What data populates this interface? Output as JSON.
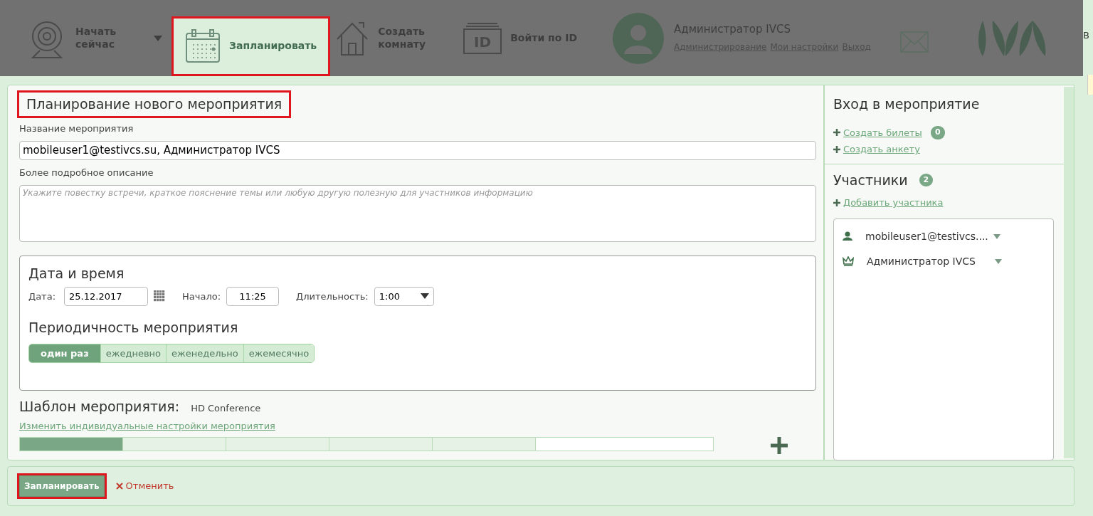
{
  "header": {
    "nav": [
      {
        "kind": "webcam",
        "label": "Начать сейчас",
        "dropdown": true,
        "selected": false,
        "highlighted": false
      },
      {
        "kind": "calendar",
        "label": "Запланировать",
        "dropdown": false,
        "selected": true,
        "highlighted": true
      },
      {
        "kind": "house",
        "label": "Создать комнату",
        "dropdown": false,
        "selected": false,
        "highlighted": false
      },
      {
        "kind": "id",
        "label": "Войти по ID",
        "icon_text": "ID",
        "dropdown": false,
        "selected": false,
        "highlighted": false
      }
    ],
    "user": {
      "name": "Администратор IVCS",
      "links": [
        "Администрирование",
        "Мои настройки",
        "Выход"
      ]
    }
  },
  "form": {
    "title": "Планирование нового мероприятия",
    "highlighted": true,
    "name_label": "Название мероприятия",
    "name_value": "mobileuser1@testivcs.su, Администратор IVCS",
    "description_label": "Более подробное описание",
    "description_placeholder": "Укажите повестку встречи, краткое пояснение темы или любую другую полезную для участников информацию",
    "datetime": {
      "title": "Дата и время",
      "date_label": "Дата:",
      "date": "25.12.2017",
      "start_label": "Начало:",
      "start": "11:25",
      "duration_label": "Длительность:",
      "duration": "1:00"
    },
    "periodicity": {
      "title": "Периодичность мероприятия",
      "options": [
        {
          "label": "один раз",
          "selected": true
        },
        {
          "label": "ежедневно",
          "selected": false
        },
        {
          "label": "еженедельно",
          "selected": false
        },
        {
          "label": "ежемесячно",
          "selected": false
        }
      ]
    },
    "template": {
      "label": "Шаблон мероприятия:",
      "value": "HD Conference",
      "link": "Изменить индивидуальные настройки мероприятия",
      "tabs": [
        {
          "selected": true
        },
        {
          "selected": false
        },
        {
          "selected": false
        },
        {
          "selected": false
        },
        {
          "selected": false
        }
      ]
    }
  },
  "sidebar": {
    "entry_title": "Вход в мероприятие",
    "entry_links": [
      {
        "label": "Создать билеты",
        "count": "0"
      },
      {
        "label": "Создать анкету"
      }
    ],
    "participants_title": "Участники",
    "participants_count": "2",
    "add_link": "Добавить участника",
    "participants": [
      {
        "kind": "user",
        "name": "mobileuser1@testivcs...."
      },
      {
        "kind": "moderator",
        "name": "Администратор IVCS"
      }
    ]
  },
  "footer": {
    "submit": "Запланировать",
    "submit_highlighted": true,
    "cancel": "Отменить"
  },
  "edge_text": "В"
}
